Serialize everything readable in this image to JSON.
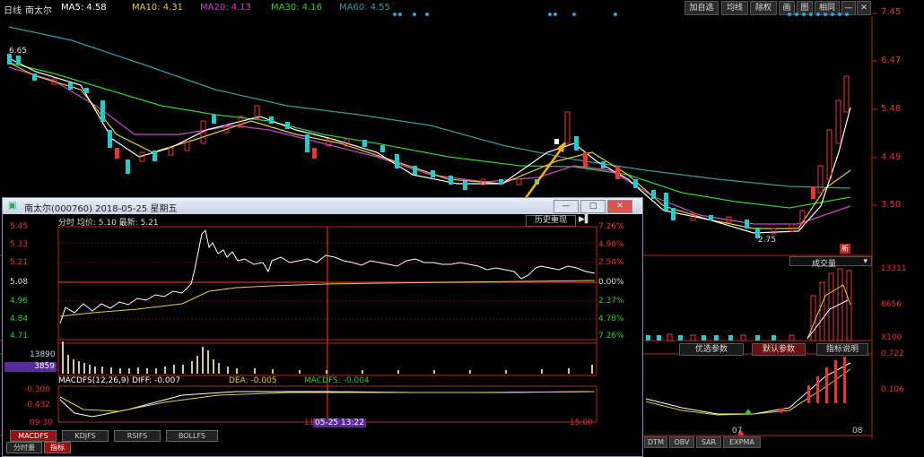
{
  "topbar": {
    "mode": "日线",
    "stock_name": "南太尔",
    "ma5": "MA5: 4.58",
    "ma10": "MA10: 4.31",
    "ma20": "MA20: 4.13",
    "ma30": "MA30: 4.16",
    "ma60": "MA60: 4.55",
    "buttons": [
      "加自选",
      "均线",
      "除权",
      "画",
      "图",
      "相同"
    ]
  },
  "colors": {
    "up": "#e33333",
    "down": "#22cccc",
    "ma5": "#ffffff",
    "ma10": "#e0d040",
    "ma20": "#cc44cc",
    "ma30": "#33cc33",
    "ma60": "#3a9a9a"
  },
  "main_chart": {
    "price_ticks": [
      "7.45",
      "6.47",
      "5.48",
      "4.49",
      "3.50"
    ],
    "high_label": "6.65",
    "low_label": "2.75",
    "volume_ticks": [
      "13311",
      "6656",
      "X100"
    ],
    "volume_label": "成交量",
    "indicator_buttons": [
      "优选参数",
      "默认参数",
      "指标说明"
    ],
    "macd_ticks": [
      "0.722",
      "0.106"
    ],
    "bottom_tabs": [
      "DTM",
      "OBV",
      "SAR",
      "EXPMA"
    ],
    "x_labels": [
      "07",
      "08"
    ],
    "flag": "新"
  },
  "popup": {
    "title": "南太尔(000760)  2018-05-25  星期五",
    "header": "分时 均价: 5.10 最新: 5.21",
    "history_button": "历史重现",
    "left_ticks": [
      "5.45",
      "5.33",
      "5.21",
      "5.08",
      "4.96",
      "4.84",
      "4.71"
    ],
    "right_ticks": [
      "7.26%",
      "4.96%",
      "2.54%",
      "0.00%",
      "2.37%",
      "4.78%",
      "7.26%"
    ],
    "vol_ticks": [
      "13890",
      "3859"
    ],
    "macd_label": "MACDFS(12,26,9) DIFF: -0.007",
    "dea_label": "DEA: -0.005",
    "macd_value_label": "MACDFS: -0.004",
    "macd_ticks": [
      "-0.300",
      "-0.432"
    ],
    "time_labels": [
      "09:30",
      "11",
      "15:00"
    ],
    "cursor_label": "05-25 13:22",
    "tabs": [
      "MACDFS",
      "KDJFS",
      "RSIFS",
      "BOLLFS"
    ],
    "small_tabs": [
      "分时量",
      "指标"
    ]
  }
}
